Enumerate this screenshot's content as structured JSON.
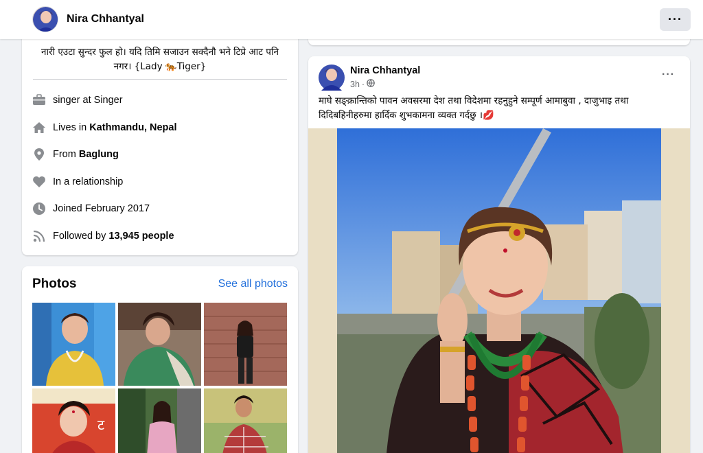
{
  "header": {
    "profile_name": "Nira Chhantyal",
    "more_label": "···"
  },
  "intro": {
    "bio": "नारी एउटा सुन्दर फुल हो। यदि तिमि सजाउन सक्दैनौ भने टिप्रे आट पनि नगर। {Lady 🐅Tiger}",
    "work": "singer at Singer",
    "lives_prefix": "Lives in ",
    "lives_place": "Kathmandu, Nepal",
    "from_prefix": "From ",
    "from_place": "Baglung",
    "relationship": "In a relationship",
    "joined": "Joined February 2017",
    "followed_prefix": "Followed by ",
    "followed_count": "13,945 people"
  },
  "photos": {
    "title": "Photos",
    "see_all": "See all photos"
  },
  "post": {
    "author": "Nira Chhantyal",
    "time": "3h",
    "dot": "·",
    "more_label": "···",
    "text": "माघे सङ्क्रान्तिको पावन अवसरमा देश तथा विदेशमा रहनुहुने सम्पूर्ण आमाबुवा , दाजुभाइ तथा दिदिबहिनीहरुमा हार्दिक शुभकामना व्यक्त गर्दछु ।💋"
  },
  "icons": {
    "work": "briefcase-icon",
    "home": "home-icon",
    "from": "location-pin-icon",
    "relationship": "heart-icon",
    "joined": "clock-icon",
    "followed": "rss-icon",
    "privacy": "globe-icon"
  },
  "colors": {
    "link": "#216fdb",
    "icon": "#8a8d91",
    "page_bg": "#f0f2f5"
  }
}
